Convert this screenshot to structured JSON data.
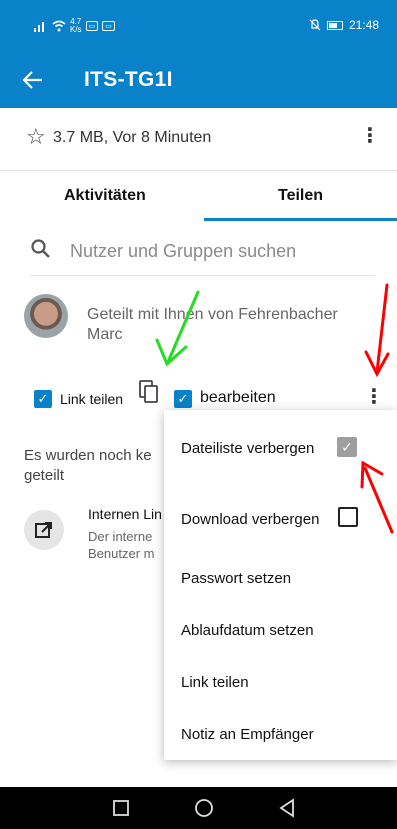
{
  "status_bar": {
    "speed": "4.7\nK/s",
    "time": "21:48"
  },
  "app_bar": {
    "back_icon": "arrow-left-icon",
    "title": "ITS-TG1I"
  },
  "file": {
    "meta": "3.7 MB, Vor 8 Minuten",
    "star_icon": "star-outline-icon",
    "menu_icon": "more-vert-icon"
  },
  "tabs": [
    {
      "label": "Aktivitäten",
      "selected": false
    },
    {
      "label": "Teilen",
      "selected": true
    }
  ],
  "search": {
    "placeholder": "Nutzer und Gruppen suchen"
  },
  "owner": {
    "text": "Geteilt mit Ihnen von Fehrenbacher Marc"
  },
  "link_share": {
    "share_label": "Link teilen",
    "share_checked": true,
    "edit_label": "bearbeiten",
    "edit_checked": true
  },
  "not_shared_text": "Es wurden noch ke\ngeteilt",
  "internal_link": {
    "title": "Internen Lin",
    "subtitle": "Der interne\nBenutzer m"
  },
  "menu": {
    "items": [
      {
        "label": "Dateiliste verbergen",
        "checked": true,
        "has_checkbox": true
      },
      {
        "label": "Download verbergen",
        "checked": false,
        "has_checkbox": true
      },
      {
        "label": "Passwort setzen"
      },
      {
        "label": "Ablaufdatum setzen"
      },
      {
        "label": "Link teilen"
      },
      {
        "label": "Notiz an Empfänger"
      }
    ]
  },
  "colors": {
    "primary": "#0a82c9",
    "annotation_red": "#ff0000",
    "annotation_green": "#22dd22"
  }
}
